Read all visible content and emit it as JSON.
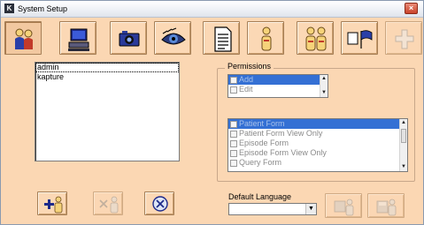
{
  "window": {
    "title": "System Setup",
    "app_icon": "K",
    "close_glyph": "×"
  },
  "toolbar": {
    "buttons": [
      {
        "icon": "users-icon",
        "state": "active"
      },
      {
        "icon": "computer-icon",
        "state": "normal"
      },
      {
        "icon": "camera-icon",
        "state": "normal"
      },
      {
        "icon": "eye-icon",
        "state": "normal"
      },
      {
        "icon": "document-icon",
        "state": "normal"
      },
      {
        "icon": "person-icon",
        "state": "normal"
      },
      {
        "icon": "user-group-icon",
        "state": "normal"
      },
      {
        "icon": "flags-icon",
        "state": "normal"
      },
      {
        "icon": "add-cross-icon",
        "state": "disabled"
      }
    ]
  },
  "users": {
    "items": [
      "admin",
      "kapture"
    ],
    "selected_index": 0
  },
  "permissions": {
    "title": "Permissions",
    "access_list": {
      "items": [
        {
          "label": "Add",
          "checked": false,
          "selected": true
        },
        {
          "label": "Edit",
          "checked": false,
          "selected": false
        }
      ]
    },
    "forms_list": {
      "items": [
        {
          "label": "Patient Form",
          "checked": false,
          "selected": true
        },
        {
          "label": "Patient Form View Only",
          "checked": false,
          "selected": false
        },
        {
          "label": "Episode Form",
          "checked": false,
          "selected": false
        },
        {
          "label": "Episode Form View Only",
          "checked": false,
          "selected": false
        },
        {
          "label": "Query Form",
          "checked": false,
          "selected": false
        }
      ]
    }
  },
  "language": {
    "label": "Default Language",
    "value": ""
  },
  "actions": {
    "add_user_icon": "add-user-icon",
    "edit_user_icon": "edit-user-icon",
    "delete_user_icon": "delete-user-icon",
    "copy_user_icon": "copy-user-icon",
    "save_user_icon": "save-user-icon"
  },
  "colors": {
    "background": "#fbd7b3",
    "selection": "#3470d4",
    "button_border": "#a67f57"
  }
}
